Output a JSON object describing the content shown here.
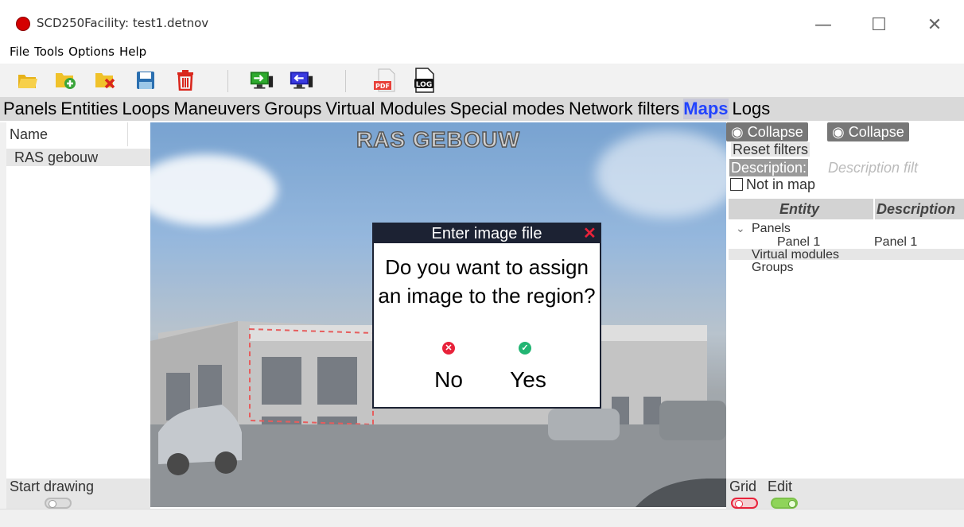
{
  "window": {
    "title": "SCD250Facility: test1.detnov",
    "minimize_glyph": "—",
    "maximize_glyph": "☐",
    "close_glyph": "✕"
  },
  "menu": [
    "File",
    "Tools",
    "Options",
    "Help"
  ],
  "toolbar": {
    "icons": [
      "open-folder-icon",
      "new-folder-icon",
      "delete-folder-icon",
      "save-icon",
      "trash-icon",
      "upload-to-device-icon",
      "download-from-device-icon",
      "pdf-icon",
      "log-icon"
    ],
    "pdf_text": "PDF",
    "log_text": "LOG"
  },
  "tabs": [
    "Panels",
    "Entities",
    "Loops",
    "Maneuvers",
    "Groups",
    "Virtual Modules",
    "Special modes",
    "Network filters",
    "Maps",
    "Logs"
  ],
  "active_tab": "Maps",
  "left": {
    "header": "Name",
    "rows": [
      "RAS gebouw"
    ],
    "start_drawing": "Start drawing"
  },
  "map": {
    "title": "RAS GEBOUW"
  },
  "dialog": {
    "title": "Enter image file",
    "close": "✕",
    "question": "Do you want to assign an image to the region?",
    "no_icon": "✕",
    "yes_icon": "✓",
    "no": "No",
    "yes": "Yes"
  },
  "right": {
    "collapse1": "Collapse",
    "collapse2": "Collapse",
    "reset_filters": "Reset filters",
    "description_label": "Description:",
    "description_placeholder": "Description filt",
    "not_in_map": "Not in map",
    "col_entity": "Entity",
    "col_description": "Description",
    "tree": {
      "panels": "Panels",
      "panel1_entity": "Panel 1",
      "panel1_desc": "Panel 1",
      "virtual_modules": "Virtual modules",
      "groups": "Groups"
    },
    "grid": "Grid",
    "edit": "Edit"
  },
  "colors": {
    "active_tab": "#2244ff",
    "dialog_header": "#1c2233",
    "no": "#e8223a",
    "yes": "#22b573"
  }
}
